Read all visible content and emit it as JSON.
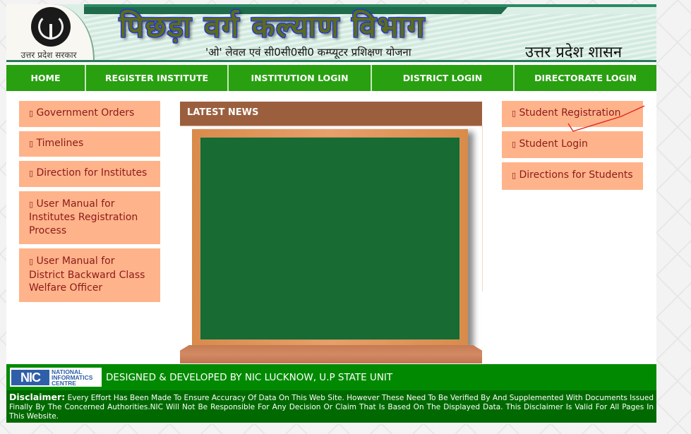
{
  "header": {
    "logo_caption": "उत्तर प्रदेश सरकार",
    "department_title": "पिछड़ा वर्ग कल्याण विभाग",
    "subtitle": "'ओ' लेवल एवं सी0सी0सी0 कम्प्यूटर प्रशिक्षण योजना",
    "government": "उत्तर प्रदेश शासन"
  },
  "nav": {
    "items": [
      {
        "label": "HOME"
      },
      {
        "label": "REGISTER INSTITUTE"
      },
      {
        "label": "INSTITUTION LOGIN"
      },
      {
        "label": "DISTRICT LOGIN"
      },
      {
        "label": "DIRECTORATE LOGIN"
      }
    ]
  },
  "left_menu": {
    "bullet": "▯",
    "items": [
      {
        "label": "Government Orders"
      },
      {
        "label": "Timelines"
      },
      {
        "label": "Direction for Institutes"
      },
      {
        "label": "User Manual for Institutes Registration Process"
      },
      {
        "label": "User Manual for District Backward Class Welfare Officer"
      }
    ]
  },
  "news": {
    "title": "LATEST NEWS"
  },
  "right_menu": {
    "bullet": "▯",
    "items": [
      {
        "label": "Student Registration"
      },
      {
        "label": "Student Login"
      },
      {
        "label": "Directions for Students"
      }
    ]
  },
  "footer": {
    "nic_mark": "NIC",
    "nic_line1": "NATIONAL",
    "nic_line2": "INFORMATICS",
    "nic_line3": "CENTRE",
    "credit": "DESIGNED & DEVELOPED BY NIC LUCKNOW, U.P STATE UNIT",
    "disclaimer_label": "Disclaimer:",
    "disclaimer_text": "Every Effort Has Been Made To Ensure Accuracy Of Data On This Web Site. However These Need To Be Verified By And Supplemented With Documents Issued Finally By The Concerned Authorities.NIC Will Not Be Responsible For Any Decision Or Claim That Is Based On The Displayed Data. This Disclaimer Is Valid For All Pages In This Website."
  },
  "colors": {
    "nav_bg": "#28a010",
    "menu_bg": "#ffb38a",
    "menu_text": "#8b1a1a",
    "news_header_bg": "#9c5f3e",
    "board_green": "#176b33",
    "footer_top": "#018a01",
    "footer_bottom": "#006a00",
    "annotation": "#e0201a"
  }
}
